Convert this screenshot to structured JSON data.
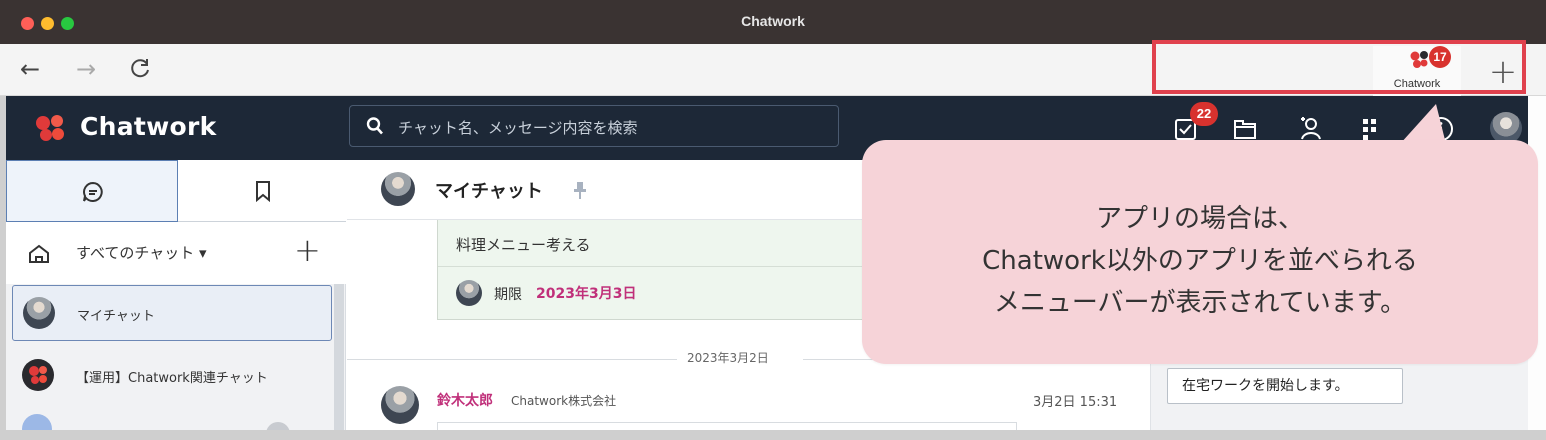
{
  "window": {
    "title": "Chatwork"
  },
  "browser": {
    "back_glyph": "←",
    "forward_glyph": "→",
    "reload_glyph": "C",
    "app_tab": {
      "label": "Chatwork",
      "badge": "17"
    },
    "add_tab_glyph": "+"
  },
  "header": {
    "brand": "Chatwork",
    "search_placeholder": "チャット名、メッセージ内容を検索",
    "task_badge": "22",
    "icons": [
      "task-icon",
      "folder-icon",
      "contact-icon",
      "apps-icon",
      "info-icon",
      "avatar"
    ]
  },
  "sidebar": {
    "filter_label": "すべてのチャット ▾",
    "add_glyph": "+",
    "rooms": [
      {
        "name": "マイチャット"
      },
      {
        "name": "【運用】Chatwork関連チャット"
      }
    ]
  },
  "room": {
    "title": "マイチャット",
    "task": {
      "text": "料理メニュー考える",
      "deadline_label": "期限",
      "deadline_date": "2023年3月3日"
    },
    "date_separator": "2023年3月2日",
    "message": {
      "sender": "鈴木太郎",
      "org": "Chatwork株式会社",
      "time": "3月2日 15:31"
    }
  },
  "right_panel": {
    "button_label": "在宅ワークを開始します。"
  },
  "callout": {
    "lines": [
      "アプリの場合は、",
      "Chatwork以外のアプリを並べられる",
      "メニューバーが表示されています。"
    ]
  },
  "colors": {
    "highlight": "#e0414d",
    "callout_bg": "#f6d3d8",
    "header_bg": "#1d2837",
    "badge": "#d8322e",
    "deadline": "#c0307a"
  }
}
